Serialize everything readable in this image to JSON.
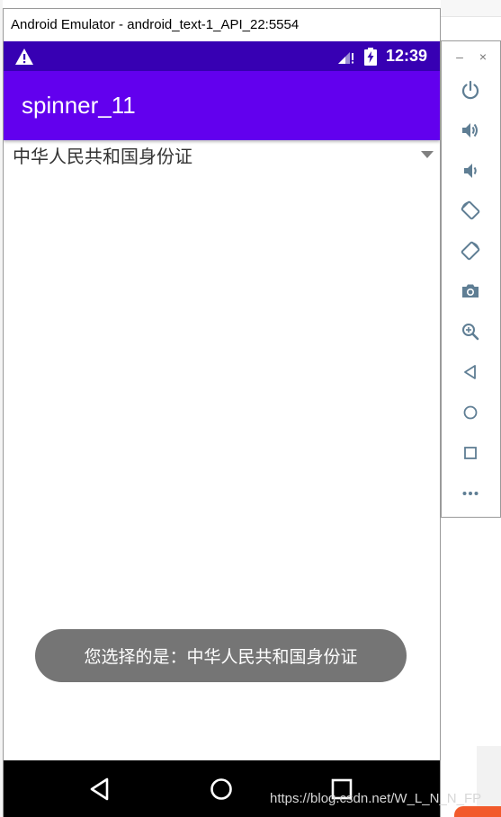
{
  "window": {
    "title": "Android Emulator - android_text-1_API_22:5554"
  },
  "status_bar": {
    "time": "12:39",
    "icons": [
      "warning-icon",
      "signal-icon",
      "battery-icon"
    ],
    "color": "#3700b3"
  },
  "app_bar": {
    "title": "spinner_11",
    "color": "#6200ee"
  },
  "spinner": {
    "selected_value": "中华人民共和国身份证"
  },
  "toast": {
    "message": "您选择的是：中华人民共和国身份证"
  },
  "nav_bar": {
    "buttons": [
      "back-icon",
      "home-icon",
      "recents-icon"
    ]
  },
  "side_panel": {
    "minimize_label": "–",
    "close_label": "×",
    "icons": [
      "power-icon",
      "volume-up-icon",
      "volume-down-icon",
      "rotate-left-icon",
      "rotate-right-icon",
      "camera-icon",
      "zoom-icon",
      "back-icon",
      "home-icon",
      "overview-icon",
      "more-icon"
    ]
  },
  "watermark": "https://blog.csdn.net/W_L_N_N_FP"
}
